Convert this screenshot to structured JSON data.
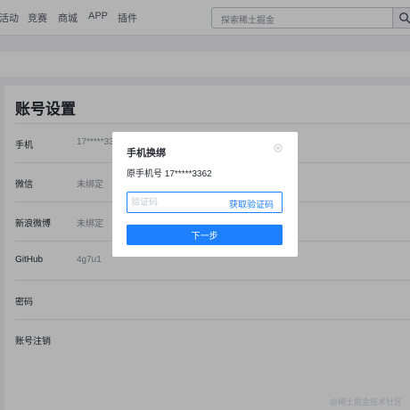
{
  "nav": {
    "items": [
      "活动",
      "竞赛",
      "商城",
      "APP",
      "插件"
    ],
    "search_placeholder": "探索稀土掘金"
  },
  "settings": {
    "title": "账号设置",
    "rows": [
      {
        "label": "手机",
        "value": "17*****33"
      },
      {
        "label": "微信",
        "value": "未绑定"
      },
      {
        "label": "新浪微博",
        "value": "未绑定"
      },
      {
        "label": "GitHub",
        "value": "4g7u1"
      },
      {
        "label": "密码",
        "value": ""
      },
      {
        "label": "账号注销",
        "value": ""
      }
    ]
  },
  "modal": {
    "title": "手机换绑",
    "phone_text": "原手机号 17*****3362",
    "code_placeholder": "验证码",
    "get_code_label": "获取验证码",
    "next_label": "下一步"
  },
  "watermark": "@稀土掘金技术社区",
  "colors": {
    "accent": "#1e80ff",
    "overlay": "rgba(0,0,0,0.30)",
    "text": "#252933",
    "muted": "#8a919f"
  }
}
